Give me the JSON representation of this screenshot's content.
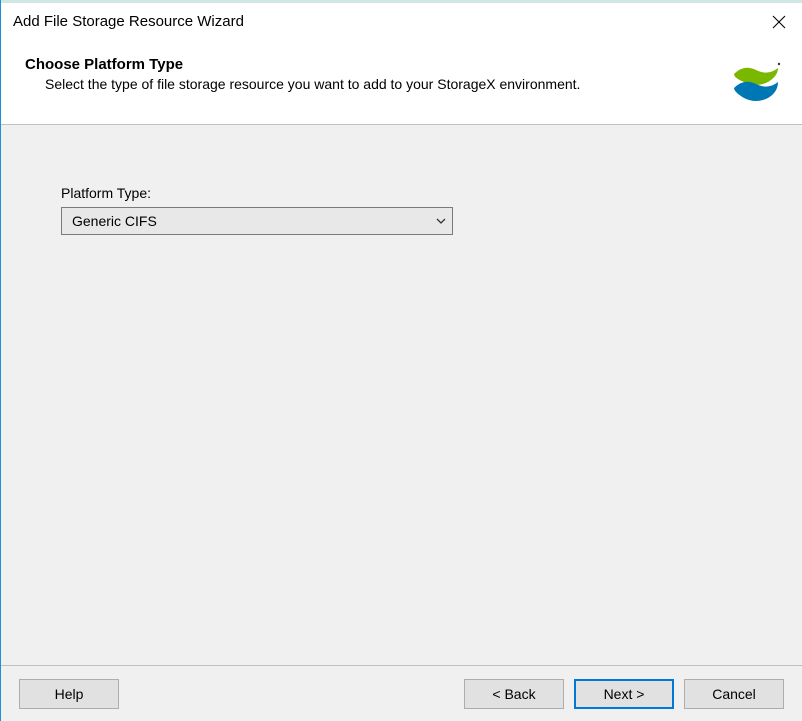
{
  "window": {
    "title": "Add File Storage Resource Wizard"
  },
  "header": {
    "title": "Choose Platform Type",
    "description": "Select the type of file storage resource you want to add to your StorageX environment."
  },
  "form": {
    "platform_type_label": "Platform Type:",
    "platform_type_value": "Generic CIFS"
  },
  "footer": {
    "help_label": "Help",
    "back_label": "< Back",
    "next_label": "Next >",
    "cancel_label": "Cancel"
  }
}
